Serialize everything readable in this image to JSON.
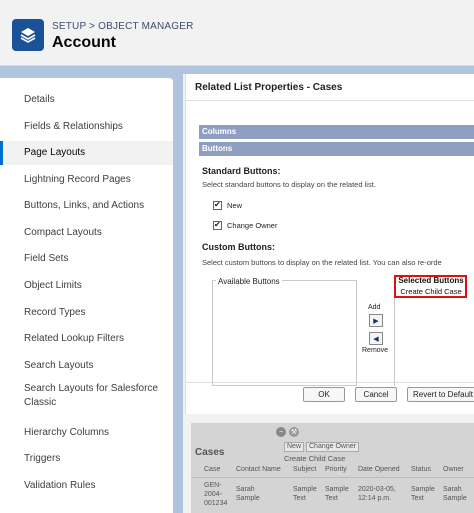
{
  "header": {
    "breadcrumb": "SETUP > OBJECT MANAGER",
    "title": "Account",
    "icon": "layers-icon"
  },
  "sidebar": {
    "items": [
      {
        "label": "Details"
      },
      {
        "label": "Fields & Relationships"
      },
      {
        "label": "Page Layouts",
        "active": true
      },
      {
        "label": "Lightning Record Pages"
      },
      {
        "label": "Buttons, Links, and Actions"
      },
      {
        "label": "Compact Layouts"
      },
      {
        "label": "Field Sets"
      },
      {
        "label": "Object Limits"
      },
      {
        "label": "Record Types"
      },
      {
        "label": "Related Lookup Filters"
      },
      {
        "label": "Search Layouts"
      },
      {
        "label": "Search Layouts for Salesforce Classic"
      },
      {
        "label": "Hierarchy Columns"
      },
      {
        "label": "Triggers"
      },
      {
        "label": "Validation Rules"
      }
    ]
  },
  "panel": {
    "title": "Related List Properties - Cases",
    "columns_label": "Columns",
    "buttons_label": "Buttons",
    "standard": {
      "title": "Standard Buttons:",
      "hint": "Select standard buttons to display on the related list.",
      "options": [
        "New",
        "Change Owner"
      ]
    },
    "custom": {
      "title": "Custom Buttons:",
      "hint": "Select custom buttons to display on the related list. You can also re-orde",
      "available_label": "Available Buttons",
      "add_label": "Add",
      "remove_label": "Remove",
      "selected_label": "Selected Buttons",
      "selected_items": [
        "Create Child Case"
      ]
    },
    "ok_label": "OK",
    "cancel_label": "Cancel",
    "revert_label": "Revert to Default"
  },
  "preview": {
    "title": "Cases",
    "buttons": [
      "New",
      "Change Owner"
    ],
    "custom_button": "Create Child Case",
    "columns": [
      "Case",
      "Contact Name",
      "Subject",
      "Priority",
      "Date Opened",
      "Status",
      "Owner"
    ],
    "row": {
      "case": [
        "GEN-",
        "2004-",
        "001234"
      ],
      "contact": [
        "Sarah",
        "Sample"
      ],
      "subject": [
        "Sample",
        "Text"
      ],
      "priority": [
        "Sample",
        "Text"
      ],
      "date": [
        "2020-03-05,",
        "12:14 p.m."
      ],
      "status": [
        "Sample",
        "Text"
      ],
      "owner": [
        "Sarah",
        "Sample"
      ]
    }
  },
  "colors": {
    "brand_blue": "#1b5297",
    "section_bar": "#8f9fc2",
    "highlight_red": "#dd1111",
    "active_accent": "#0070d2"
  }
}
